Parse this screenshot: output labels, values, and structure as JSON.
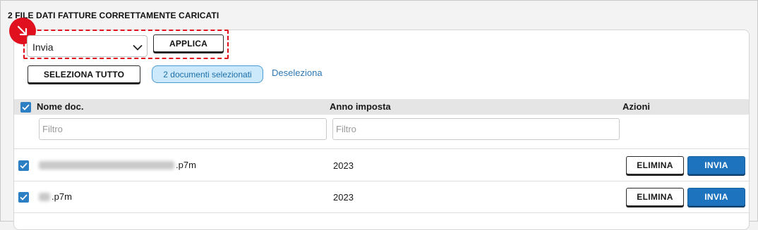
{
  "section": {
    "title": "2 FILE DATI FATTURE CORRETTAMENTE CARICATI"
  },
  "colors": {
    "accent": "#1e73be",
    "highlight": "#e0101e",
    "pill_bg": "#cce9fb"
  },
  "toolbar": {
    "action_select_value": "Invia",
    "apply_label": "APPLICA",
    "select_all_label": "SELEZIONA TUTTO",
    "selected_count_label": "2 documenti selezionati",
    "deselect_label": "Deseleziona"
  },
  "table": {
    "columns": {
      "name": "Nome doc.",
      "year": "Anno imposta",
      "actions": "Azioni"
    },
    "filters": {
      "name_placeholder": "Filtro",
      "year_placeholder": "Filtro"
    },
    "rows": [
      {
        "checked": true,
        "name_suffix": ".p7m",
        "year": "2023",
        "delete_label": "ELIMINA",
        "send_label": "INVIA"
      },
      {
        "checked": true,
        "name_suffix": ".p7m",
        "year": "2023",
        "delete_label": "ELIMINA",
        "send_label": "INVIA"
      }
    ]
  },
  "icons": {
    "pointer": "arrow-down-right-icon",
    "select_chevron": "chevron-down-icon",
    "checkbox": "checkmark-icon"
  }
}
